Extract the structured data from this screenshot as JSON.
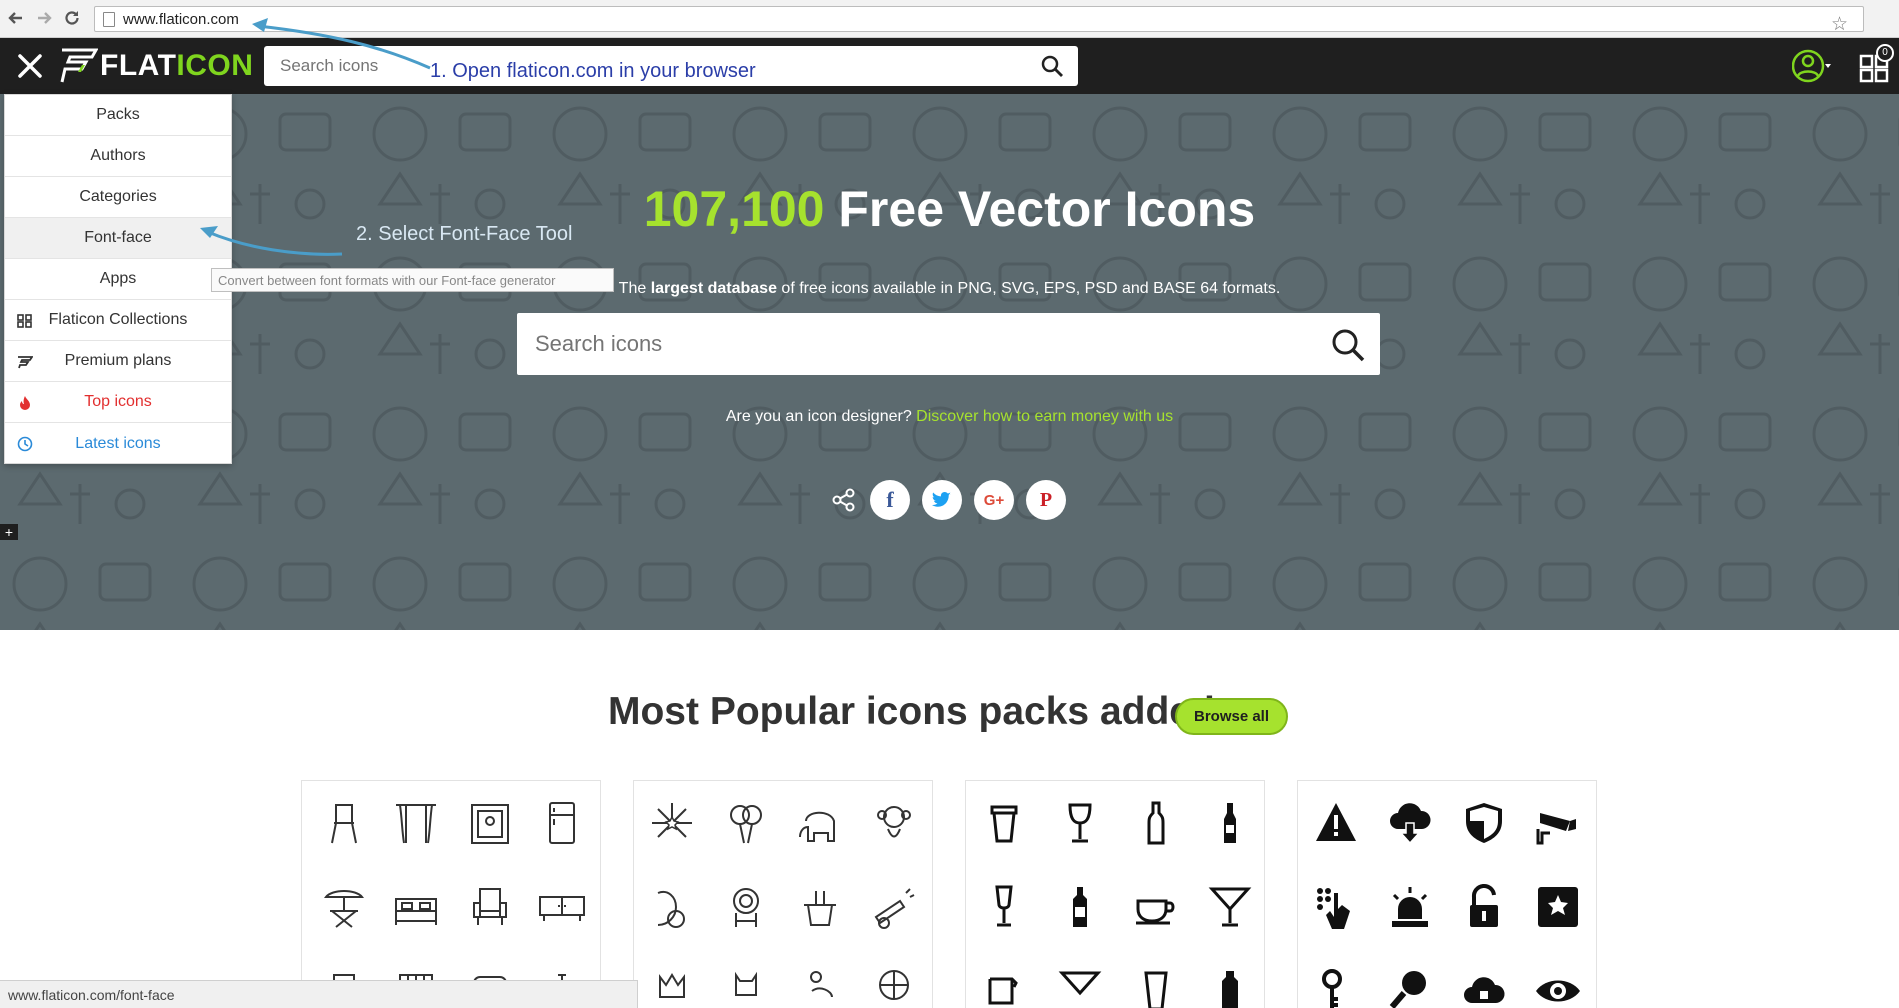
{
  "browser": {
    "url": "www.flaticon.com",
    "back_icon": "back-arrow-icon",
    "forward_icon": "forward-arrow-icon",
    "reload_icon": "reload-icon",
    "bookmark_icon": "star-icon"
  },
  "header": {
    "logo_part1": "FLAT",
    "logo_part2": "ICON",
    "search_placeholder": "Search icons",
    "cart_count": "0",
    "brand_color": "#a6e22e"
  },
  "menu": {
    "items": [
      {
        "label": "Packs"
      },
      {
        "label": "Authors"
      },
      {
        "label": "Categories"
      },
      {
        "label": "Font-face"
      },
      {
        "label": "Apps"
      },
      {
        "label": "Flaticon Collections",
        "icon": "collections-icon"
      },
      {
        "label": "Premium plans",
        "icon": "premium-icon"
      },
      {
        "label": "Top icons",
        "icon": "fire-icon",
        "color": "#e22f2f"
      },
      {
        "label": "Latest icons",
        "icon": "clock-icon",
        "color": "#2a8ad8"
      }
    ],
    "tooltip": "Convert between font formats with our Font-face generator"
  },
  "hero": {
    "count": "107,100",
    "title_rest": " Free Vector Icons",
    "sub_pre": "The ",
    "sub_bold": "largest database",
    "sub_post": " of free icons available in PNG, SVG, EPS, PSD and BASE 64 formats.",
    "search_placeholder": "Search icons",
    "designer_q": "Are you an icon designer? ",
    "designer_link": "Discover how to earn money with us",
    "social": [
      "facebook-icon",
      "twitter-icon",
      "google-plus-icon",
      "pinterest-icon"
    ]
  },
  "annotations": {
    "step1": "1. Open flaticon.com in your browser",
    "step2": "2. Select Font-Face Tool"
  },
  "packs": {
    "title": "Most Popular icons packs added",
    "browse_label": "Browse all"
  },
  "status_bar": "www.flaticon.com/font-face"
}
